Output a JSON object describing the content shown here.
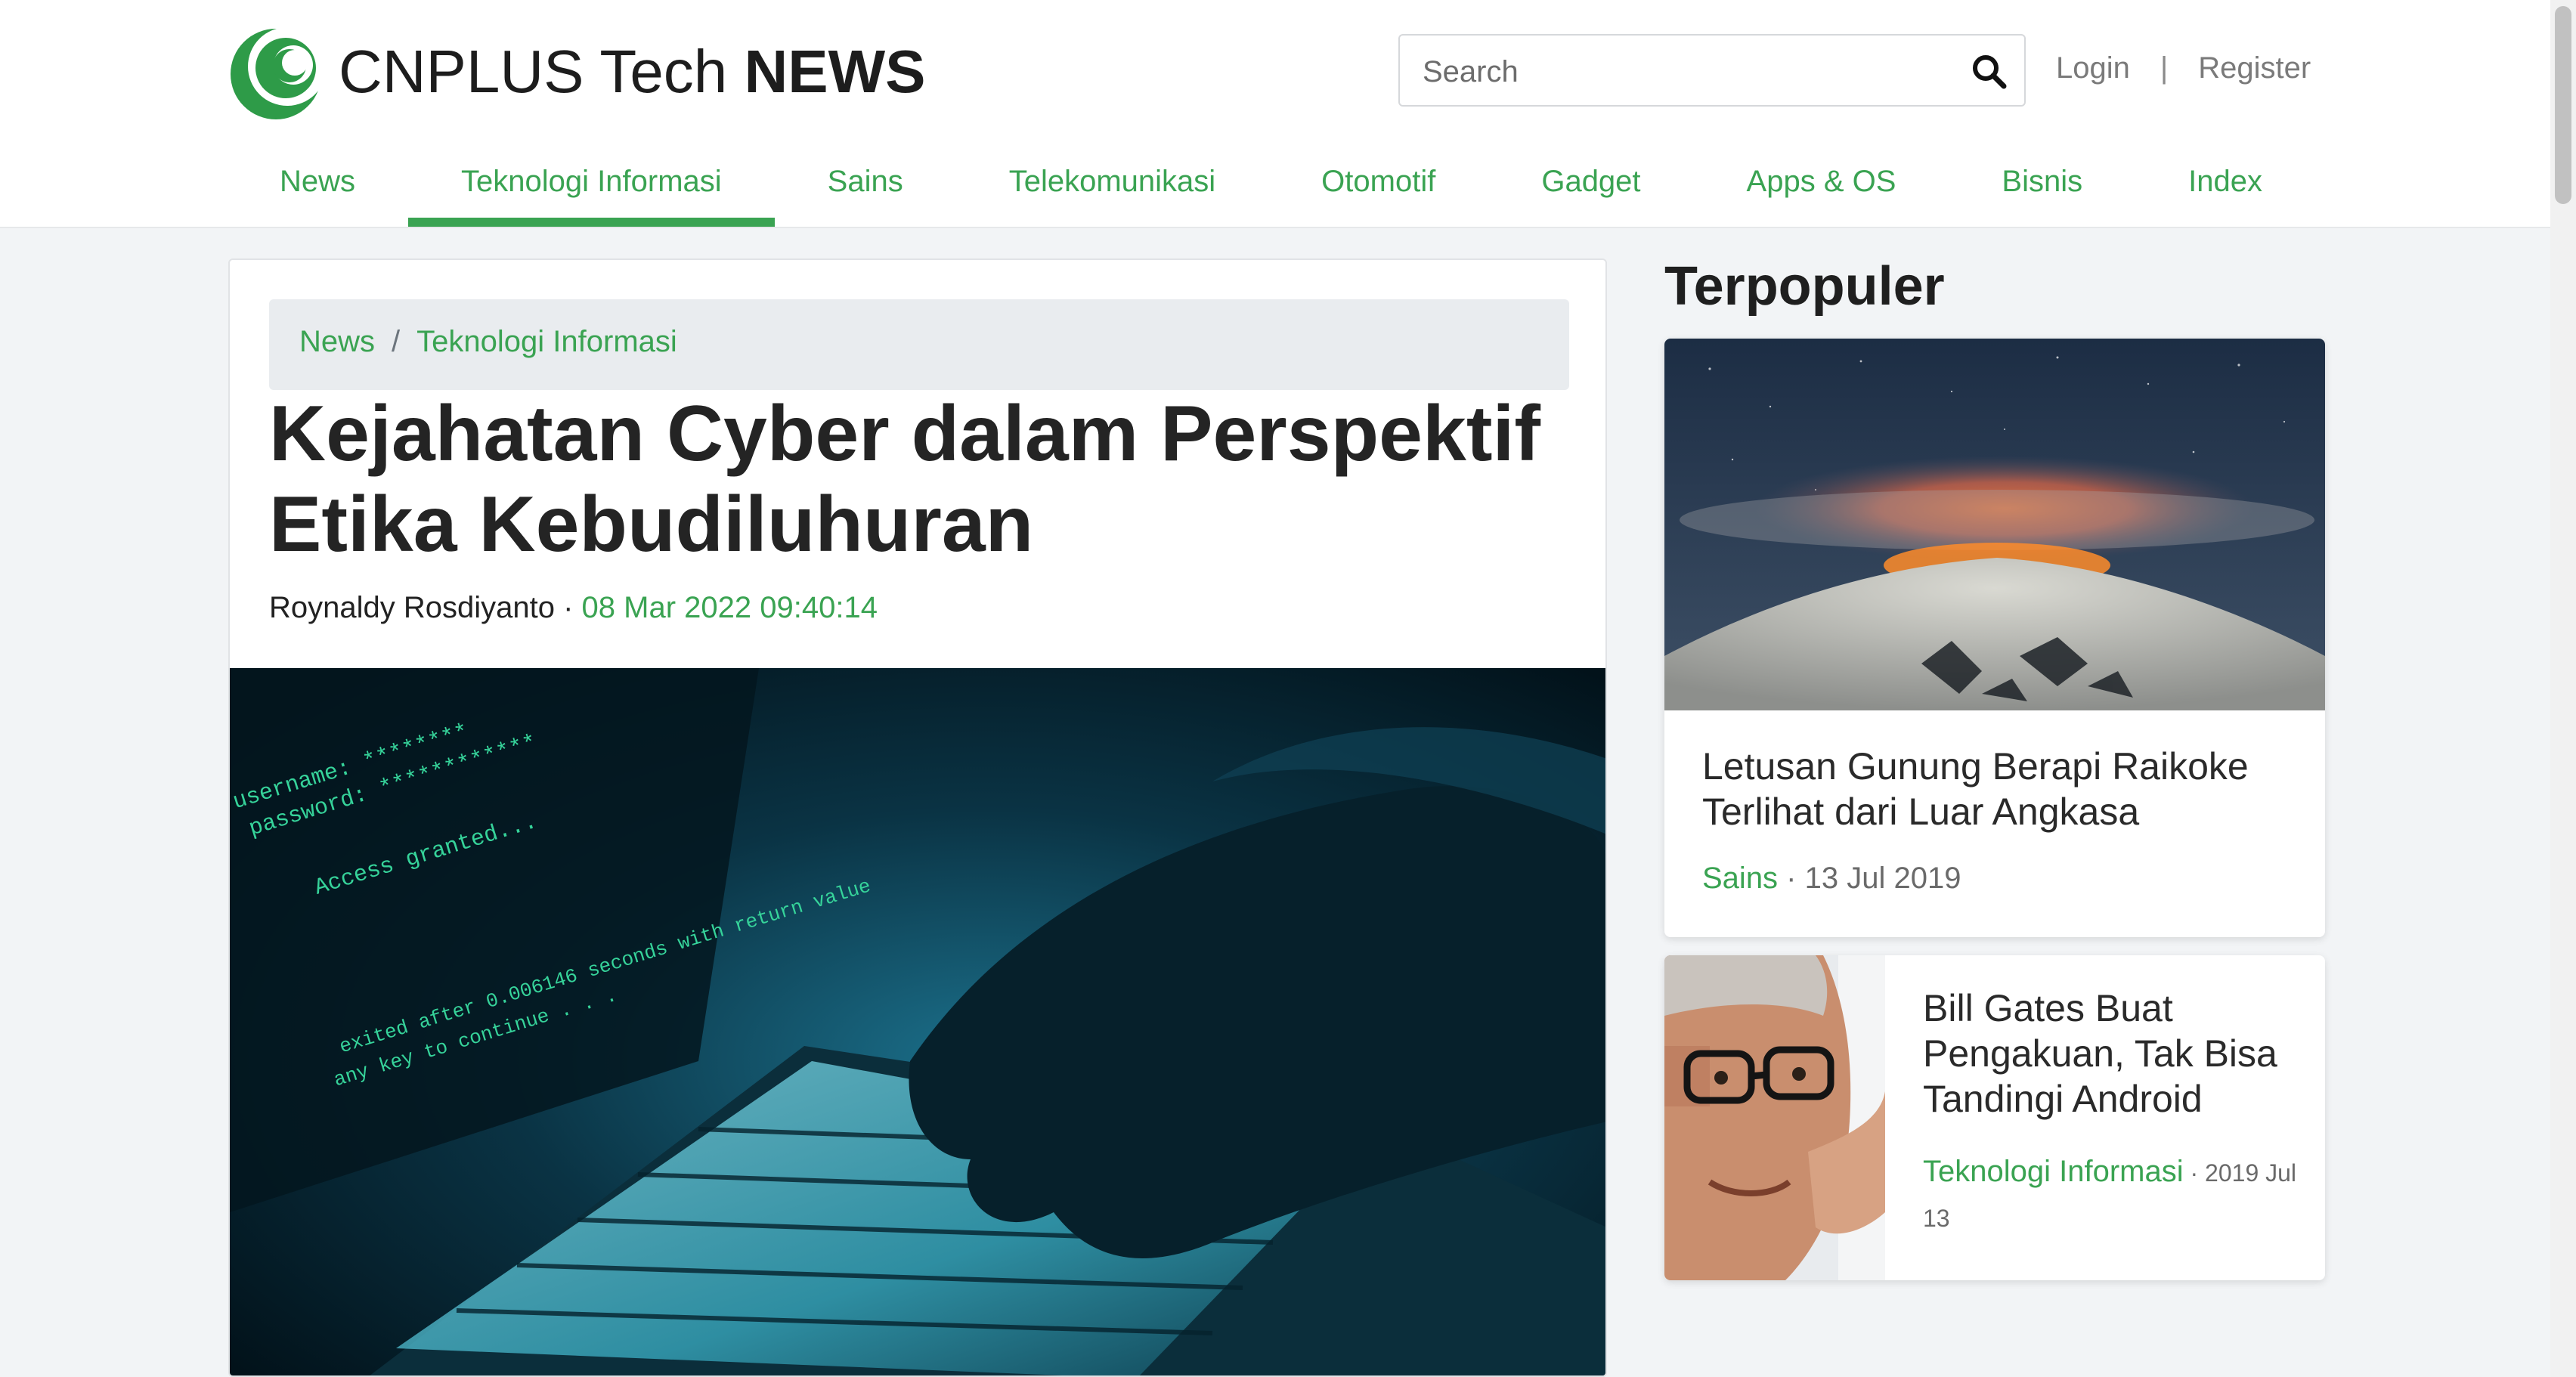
{
  "brand": {
    "name_regular": "CNPLUS Tech ",
    "name_bold": "NEWS",
    "logo_icon": "crescent-logo-icon",
    "accent_color": "#3aa352"
  },
  "search": {
    "placeholder": "Search",
    "value": "",
    "icon": "search-icon"
  },
  "auth": {
    "login": "Login",
    "separator": "|",
    "register": "Register"
  },
  "nav": {
    "items": [
      {
        "label": "News",
        "active": false
      },
      {
        "label": "Teknologi Informasi",
        "active": true
      },
      {
        "label": "Sains",
        "active": false
      },
      {
        "label": "Telekomunikasi",
        "active": false
      },
      {
        "label": "Otomotif",
        "active": false
      },
      {
        "label": "Gadget",
        "active": false
      },
      {
        "label": "Apps & OS",
        "active": false
      },
      {
        "label": "Bisnis",
        "active": false
      },
      {
        "label": "Index",
        "active": false
      }
    ]
  },
  "article": {
    "breadcrumb": [
      "News",
      "Teknologi Informasi"
    ],
    "breadcrumb_separator": "/",
    "title": "Kejahatan Cyber dalam Perspektif Etika Kebudiluhuran",
    "author": "Roynaldy Rosdiyanto",
    "byline_separator": " · ",
    "date": "08 Mar 2022 09:40:14",
    "hero_text": {
      "line1": "username: ********",
      "line2": "password: ************",
      "line3": "Access granted...",
      "line4": "exited after 0.006146 seconds with return value",
      "line5": "any key to continue . . ."
    }
  },
  "sidebar": {
    "title": "Terpopuler",
    "cards": [
      {
        "title": "Letusan Gunung Berapi Raikoke Terlihat dari Luar Angkasa",
        "category": "Sains",
        "separator": " · ",
        "date": "13 Jul 2019"
      },
      {
        "title": "Bill Gates Buat Pengakuan, Tak Bisa Tandingi Android",
        "category": "Teknologi Informasi",
        "separator": " · ",
        "date": "2019 Jul 13"
      }
    ]
  }
}
